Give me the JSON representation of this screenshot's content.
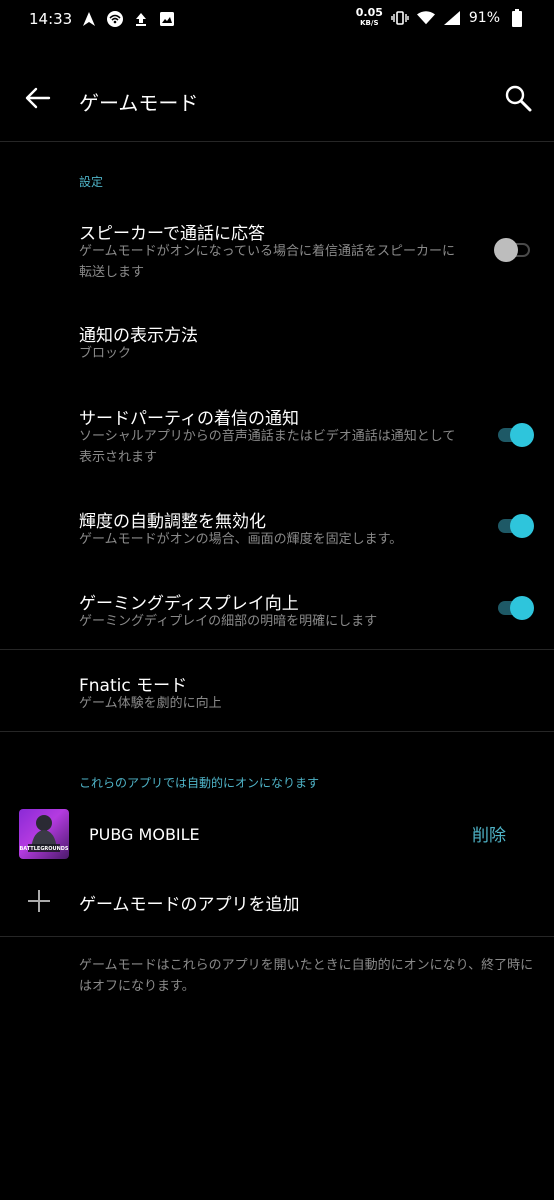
{
  "status_bar": {
    "time": "14:33",
    "net_speed_value": "0.05",
    "net_speed_unit": "KB/S",
    "battery": "91%",
    "icons": [
      "navigation-icon",
      "hotspot-icon",
      "upload-icon",
      "image-icon",
      "vibrate-icon",
      "wifi-icon",
      "signal-icon",
      "battery-icon"
    ]
  },
  "app_bar": {
    "title": "ゲームモード"
  },
  "sections": {
    "settings_header": "設定",
    "apps_header": "これらのアプリでは自動的にオンになります"
  },
  "settings": [
    {
      "title": "スピーカーで通話に応答",
      "subtitle": "ゲームモードがオンになっている場合に着信通話をスピーカーに転送します",
      "toggle": "off"
    },
    {
      "title": "通知の表示方法",
      "subtitle": "ブロック"
    },
    {
      "title": "サードパーティの着信の通知",
      "subtitle": "ソーシャルアプリからの音声通話またはビデオ通話は通知として表示されます",
      "toggle": "on"
    },
    {
      "title": "輝度の自動調整を無効化",
      "subtitle": "ゲームモードがオンの場合、画面の輝度を固定します。",
      "toggle": "on"
    },
    {
      "title": "ゲーミングディスプレイ向上",
      "subtitle": "ゲーミングディプレイの細部の明暗を明確にします",
      "toggle": "on"
    }
  ],
  "fnatic": {
    "title": "Fnatic モード",
    "subtitle": "ゲーム体験を劇的に向上"
  },
  "apps": [
    {
      "name": "PUBG MOBILE",
      "remove_label": "削除",
      "icon_text": "BATTLEGROUNDS"
    }
  ],
  "add_app_label": "ゲームモードのアプリを追加",
  "footer_note": "ゲームモードはこれらのアプリを開いたときに自動的にオンになり、終了時にはオフになります。",
  "colors": {
    "background": "#000000",
    "accent": "#2ec5dc",
    "section_header": "#4fb3c7",
    "subtitle": "#8a8a8a"
  }
}
